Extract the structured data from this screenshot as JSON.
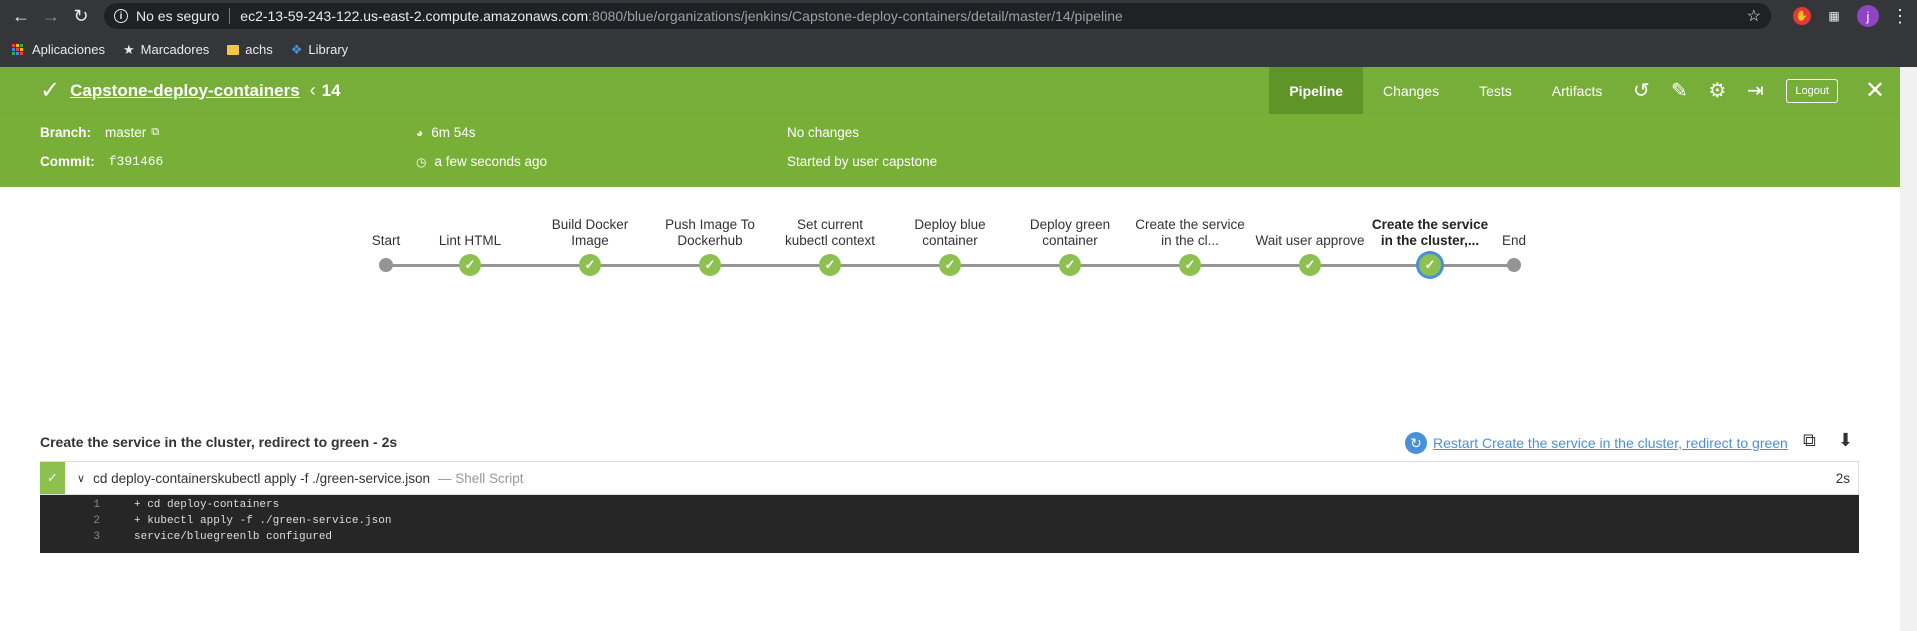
{
  "browser": {
    "security_label": "No es seguro",
    "url_host": "ec2-13-59-243-122.us-east-2.compute.amazonaws.com",
    "url_rest": ":8080/blue/organizations/jenkins/Capstone-deploy-containers/detail/master/14/pipeline",
    "avatar_letter": "j",
    "bookmarks": [
      {
        "label": "Aplicaciones",
        "icon": "apps-grid-icon"
      },
      {
        "label": "Marcadores",
        "icon": "star-icon"
      },
      {
        "label": "achs",
        "icon": "folder-icon"
      },
      {
        "label": "Library",
        "icon": "library-icon"
      }
    ]
  },
  "header": {
    "job_name": "Capstone-deploy-containers",
    "run_number": "14",
    "tabs": [
      {
        "label": "Pipeline",
        "active": true
      },
      {
        "label": "Changes",
        "active": false
      },
      {
        "label": "Tests",
        "active": false
      },
      {
        "label": "Artifacts",
        "active": false
      }
    ],
    "logout_label": "Logout",
    "status_color": "#77ae3a"
  },
  "summary": {
    "branch_label": "Branch:",
    "branch_value": "master",
    "commit_label": "Commit:",
    "commit_value": "f391466",
    "duration": "6m 54s",
    "finished": "a few seconds ago",
    "changes": "No changes",
    "started_by": "Started by user capstone"
  },
  "pipeline": {
    "stages": [
      {
        "line1": "Start",
        "line2": "",
        "kind": "dot"
      },
      {
        "line1": "Lint HTML",
        "line2": "",
        "kind": "success"
      },
      {
        "line1": "Build Docker",
        "line2": "Image",
        "kind": "success"
      },
      {
        "line1": "Push Image To",
        "line2": "Dockerhub",
        "kind": "success"
      },
      {
        "line1": "Set current",
        "line2": "kubectl context",
        "kind": "success"
      },
      {
        "line1": "Deploy blue",
        "line2": "container",
        "kind": "success"
      },
      {
        "line1": "Deploy green",
        "line2": "container",
        "kind": "success"
      },
      {
        "line1": "Create the service",
        "line2": "in the cl...",
        "kind": "success"
      },
      {
        "line1": "Wait user approve",
        "line2": "",
        "kind": "success"
      },
      {
        "line1": "Create the service",
        "line2": "in the cluster,...",
        "kind": "selected"
      },
      {
        "line1": "End",
        "line2": "",
        "kind": "dot"
      }
    ]
  },
  "step": {
    "title": "Create the service in the cluster, redirect to green - 2s",
    "restart_label": "Restart Create the service in the cluster, redirect to green",
    "command": "cd deploy-containerskubectl apply -f ./green-service.json",
    "type_label": "— Shell Script",
    "duration": "2s",
    "log": [
      {
        "n": "1",
        "text": "+ cd deploy-containers"
      },
      {
        "n": "2",
        "text": "+ kubectl apply -f ./green-service.json"
      },
      {
        "n": "3",
        "text": "service/bluegreenlb configured"
      }
    ]
  }
}
